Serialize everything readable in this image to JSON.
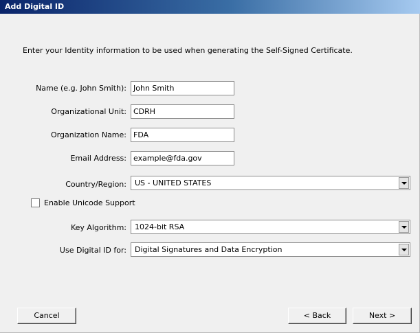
{
  "window": {
    "title": "Add Digital ID"
  },
  "intro": {
    "text": "Enter your Identity information to be used when generating the Self-Signed Certificate."
  },
  "fields": {
    "name": {
      "label": "Name (e.g. John Smith):",
      "value": "John Smith"
    },
    "org_unit": {
      "label": "Organizational Unit:",
      "value": "CDRH"
    },
    "org_name": {
      "label": "Organization Name:",
      "value": "FDA"
    },
    "email": {
      "label": "Email Address:",
      "value": "example@fda.gov"
    },
    "country": {
      "label": "Country/Region:",
      "value": "US - UNITED STATES"
    },
    "unicode": {
      "label": "Enable Unicode Support",
      "checked": false
    },
    "key_algorithm": {
      "label": "Key Algorithm:",
      "value": "1024-bit RSA"
    },
    "use_for": {
      "label": "Use Digital ID for:",
      "value": "Digital Signatures and Data Encryption"
    }
  },
  "buttons": {
    "cancel": "Cancel",
    "back": "< Back",
    "next": "Next >"
  },
  "colors": {
    "titlebar_start": "#0a246a",
    "titlebar_end": "#a6caf0",
    "dialog_bg": "#f0f0f0"
  }
}
